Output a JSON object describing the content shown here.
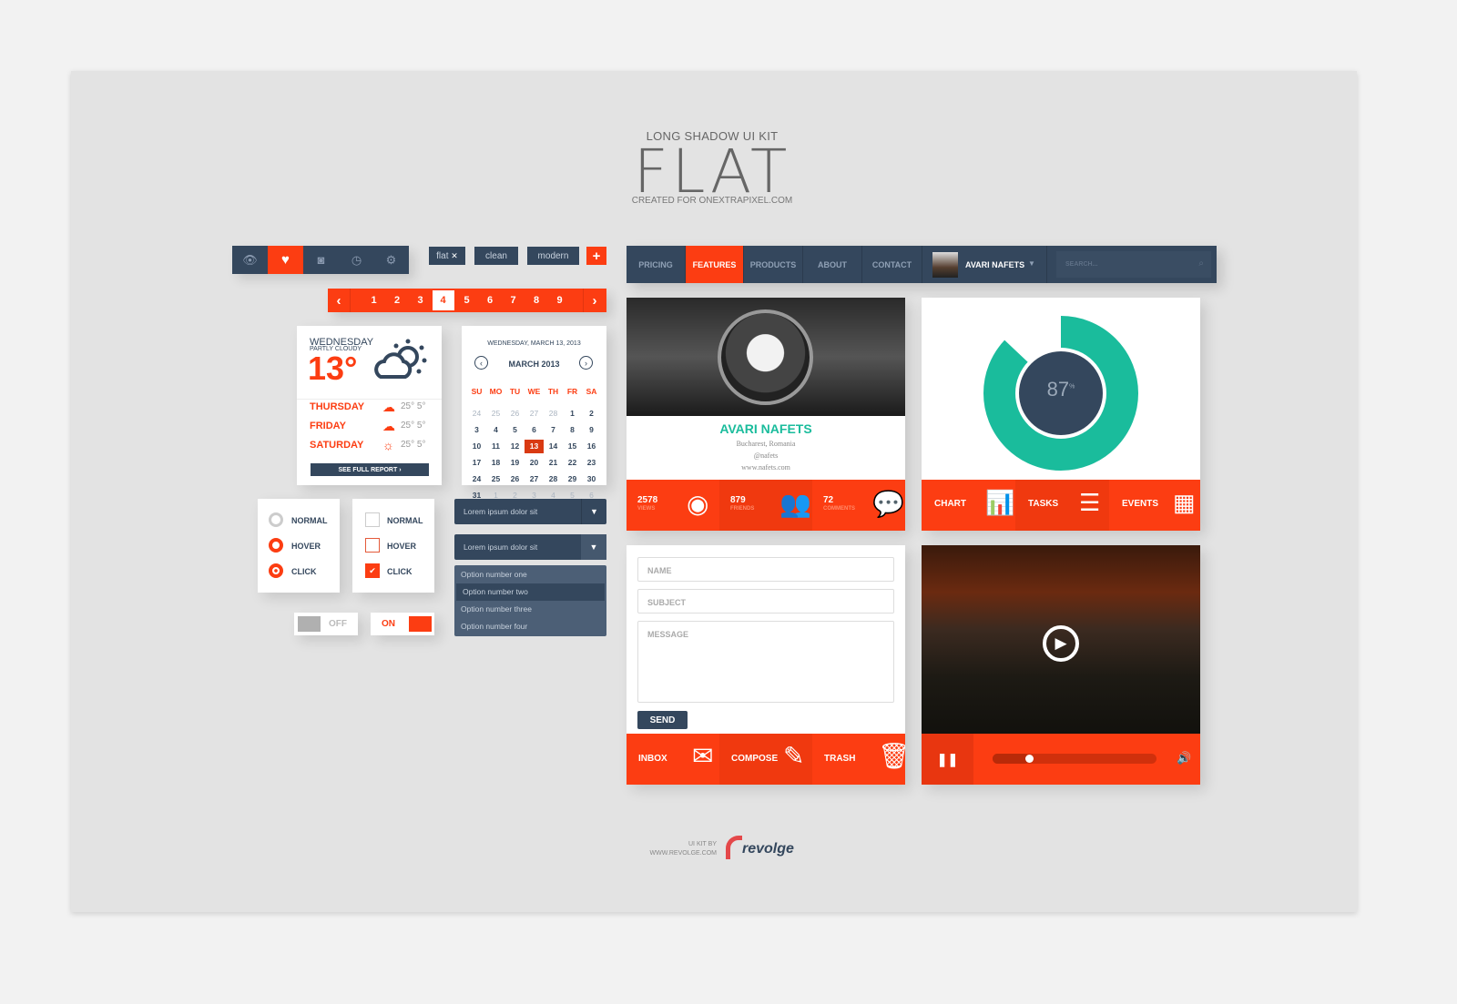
{
  "header": {
    "subtitle": "LONG SHADOW UI KIT",
    "title": "FLAT",
    "credit": "CREATED FOR ONEXTRAPIXEL.COM"
  },
  "toolbar": {
    "icons": [
      "eye-icon",
      "heart-icon",
      "camera-icon",
      "clock-icon",
      "gear-icon"
    ],
    "active": 1
  },
  "tags": {
    "items": [
      "flat",
      "clean",
      "modern"
    ],
    "add_label": "+"
  },
  "pagination": {
    "pages": [
      "1",
      "2",
      "3",
      "4",
      "5",
      "6",
      "7",
      "8",
      "9"
    ],
    "current": "4"
  },
  "weather": {
    "day": "WEDNESDAY",
    "condition": "PARTLY CLOUDY",
    "temp": "13°",
    "forecast": [
      {
        "day": "THURSDAY",
        "icon": "rain-cloud-icon",
        "temps": "25° 5°"
      },
      {
        "day": "FRIDAY",
        "icon": "rain-cloud-icon",
        "temps": "25° 5°"
      },
      {
        "day": "SATURDAY",
        "icon": "sun-icon",
        "temps": "25° 5°"
      }
    ],
    "button": "SEE FULL REPORT ›"
  },
  "calendar": {
    "date": "WEDNESDAY, MARCH 13, 2013",
    "month": "MARCH 2013",
    "weekdays": [
      "SU",
      "MO",
      "TU",
      "WE",
      "TH",
      "FR",
      "SA"
    ],
    "weeks": [
      [
        "24",
        "25",
        "26",
        "27",
        "28",
        "1",
        "2"
      ],
      [
        "3",
        "4",
        "5",
        "6",
        "7",
        "8",
        "9"
      ],
      [
        "10",
        "11",
        "12",
        "13",
        "14",
        "15",
        "16"
      ],
      [
        "17",
        "18",
        "19",
        "20",
        "21",
        "22",
        "23"
      ],
      [
        "24",
        "25",
        "26",
        "27",
        "28",
        "29",
        "30"
      ],
      [
        "31",
        "1",
        "2",
        "3",
        "4",
        "5",
        "6"
      ]
    ],
    "selected": "13"
  },
  "radios": [
    "NORMAL",
    "HOVER",
    "CLICK"
  ],
  "checkboxes": [
    "NORMAL",
    "HOVER",
    "CLICK"
  ],
  "toggles": {
    "off": "OFF",
    "on": "ON"
  },
  "dropdowns": {
    "first": "Lorem ipsum dolor sit",
    "second": "Lorem ipsum dolor sit",
    "options": [
      "Option number one",
      "Option number two",
      "Option number three",
      "Option number four"
    ],
    "highlighted": 1
  },
  "nav": {
    "items": [
      "PRICING",
      "FEATURES",
      "PRODUCTS",
      "ABOUT",
      "CONTACT"
    ],
    "active": "FEATURES",
    "user": "AVARI NAFETS",
    "search_placeholder": "SEARCH..."
  },
  "profile": {
    "name": "AVARI NAFETS",
    "location": "Bucharest, Romania",
    "handle": "@nafets",
    "website": "www.nafets.com",
    "stats": [
      {
        "value": "2578",
        "label": "VIEWS",
        "icon": "eye-icon"
      },
      {
        "value": "879",
        "label": "FRIENDS",
        "icon": "users-icon"
      },
      {
        "value": "72",
        "label": "COMMENTS",
        "icon": "speech-bubble-icon"
      }
    ]
  },
  "progress": {
    "percent": 87,
    "label": "87",
    "unit": "%",
    "color": "#1abc9c"
  },
  "widgets": [
    "CHART",
    "TASKS",
    "EVENTS"
  ],
  "form": {
    "name_placeholder": "NAME",
    "subject_placeholder": "SUBJECT",
    "message_placeholder": "MESSAGE",
    "send": "SEND"
  },
  "mail": [
    "INBOX",
    "COMPOSE",
    "TRASH"
  ],
  "video": {
    "progress": 0.2
  },
  "footer": {
    "line1": "UI KIT BY",
    "line2": "WWW.REVOLGE.COM",
    "logo": "revolge"
  },
  "colors": {
    "accent": "#fc3d12",
    "dark": "#34475d",
    "teal": "#1abc9c"
  }
}
